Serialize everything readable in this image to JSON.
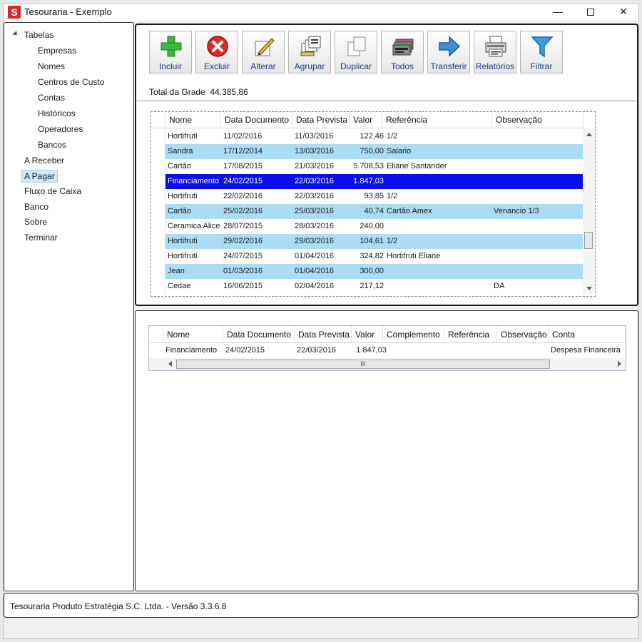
{
  "window": {
    "title": "Tesouraria - Exemplo",
    "icon_letter": "S",
    "minimize": "—",
    "close": "✕"
  },
  "nav": {
    "root": "Tabelas",
    "children": [
      "Empresas",
      "Nomes",
      "Centros de Custo",
      "Contas",
      "Históricos",
      "Operadores",
      "Bancos"
    ],
    "items": [
      "A Receber",
      "A Pagar",
      "Fluxo de Caixa",
      "Banco",
      "Sobre",
      "Terminar"
    ],
    "selected": "A Pagar"
  },
  "toolbar": {
    "buttons": [
      {
        "label": "Incluir",
        "icon": "plus-icon"
      },
      {
        "label": "Excluir",
        "icon": "delete-icon"
      },
      {
        "label": "Alterar",
        "icon": "edit-icon"
      },
      {
        "label": "Agrupar",
        "icon": "group-icon"
      },
      {
        "label": "Duplicar",
        "icon": "duplicate-icon"
      },
      {
        "label": "Todos",
        "icon": "all-icon"
      },
      {
        "label": "Transferir",
        "icon": "transfer-icon"
      },
      {
        "label": "Relatórios",
        "icon": "print-icon"
      },
      {
        "label": "Filtrar",
        "icon": "filter-icon"
      }
    ],
    "total_label": "Total da Grade",
    "total_value": "44.385,86"
  },
  "grid": {
    "columns": [
      "Nome",
      "Data Documento",
      "Data Prevista",
      "Valor",
      "Referência",
      "Observação"
    ],
    "rows": [
      [
        "Hortifruti",
        "11/02/2016",
        "11/03/2016",
        "122,46",
        "1/2",
        ""
      ],
      [
        "Sandra",
        "17/12/2014",
        "13/03/2016",
        "750,00",
        "Salario",
        ""
      ],
      [
        "Cartão",
        "17/08/2015",
        "21/03/2016",
        "5.708,53",
        "Eliane Santander",
        ""
      ],
      [
        "Financiamento",
        "24/02/2015",
        "22/03/2016",
        "1.847,03",
        "",
        ""
      ],
      [
        "Hortifruti",
        "22/02/2016",
        "22/03/2016",
        "93,85",
        "1/2",
        ""
      ],
      [
        "Cartão",
        "25/02/2016",
        "25/03/2016",
        "40,74",
        "Cartão Amex",
        "Venancio 1/3"
      ],
      [
        "Ceramica Alice",
        "28/07/2015",
        "28/03/2016",
        "240,00",
        "",
        ""
      ],
      [
        "Hortifruti",
        "29/02/2016",
        "29/03/2016",
        "104,61",
        "1/2",
        ""
      ],
      [
        "Hortifruti",
        "24/07/2015",
        "01/04/2016",
        "324,82",
        "Hortifruti Eliane",
        ""
      ],
      [
        "Jean",
        "01/03/2016",
        "01/04/2016",
        "300,00",
        "",
        ""
      ],
      [
        "Cedae",
        "16/06/2015",
        "02/04/2016",
        "217,12",
        "",
        "DA"
      ]
    ],
    "selected_row": 3
  },
  "detail": {
    "columns": [
      "Nome",
      "Data Documento",
      "Data Prevista",
      "Valor",
      "Complemento",
      "Referência",
      "Observação",
      "Conta"
    ],
    "rows": [
      [
        "Financiamento",
        "24/02/2015",
        "22/03/2016",
        "1.847,03",
        "",
        "",
        "",
        "Despesa Financeira"
      ]
    ],
    "scroll_grip": "III"
  },
  "status": {
    "text": "Tesouraria Produto Estratégia S.C. Ltda. -  Versão 3.3.6.8"
  },
  "colors": {
    "selection": "#0a0ee8",
    "alt_row": "#aadcf5",
    "button_label": "#1a3d8a"
  }
}
